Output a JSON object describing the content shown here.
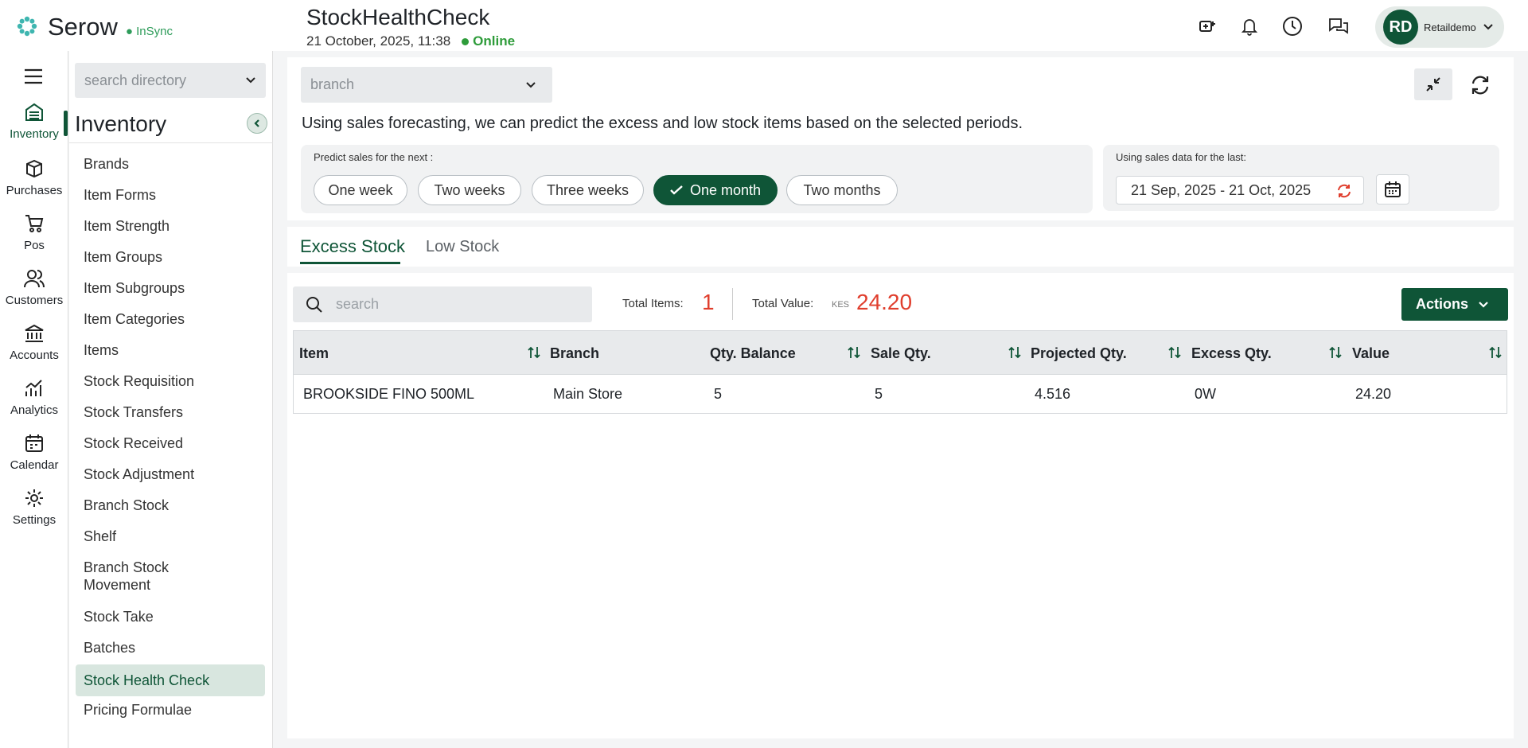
{
  "brand": {
    "name": "Serow",
    "sync_status": "InSync"
  },
  "header": {
    "title": "StockHealthCheck",
    "datetime": "21 October, 2025, 11:38",
    "connection": "Online",
    "user": {
      "initials": "RD",
      "name": "Retaildemo"
    }
  },
  "rail": {
    "items": [
      {
        "label": "Inventory",
        "icon": "inventory-icon"
      },
      {
        "label": "Purchases",
        "icon": "box-icon"
      },
      {
        "label": "Pos",
        "icon": "cart-icon"
      },
      {
        "label": "Customers",
        "icon": "users-icon"
      },
      {
        "label": "Accounts",
        "icon": "bank-icon"
      },
      {
        "label": "Analytics",
        "icon": "analytics-icon"
      },
      {
        "label": "Calendar",
        "icon": "calendar-icon"
      },
      {
        "label": "Settings",
        "icon": "gear-icon"
      }
    ]
  },
  "sidebar": {
    "search_placeholder": "search directory",
    "title": "Inventory",
    "items": [
      {
        "label": "Brands"
      },
      {
        "label": "Item Forms"
      },
      {
        "label": "Item Strength"
      },
      {
        "label": "Item Groups"
      },
      {
        "label": "Item Subgroups"
      },
      {
        "label": "Item Categories"
      },
      {
        "label": "Items"
      },
      {
        "label": "Stock Requisition"
      },
      {
        "label": "Stock Transfers"
      },
      {
        "label": "Stock Received"
      },
      {
        "label": "Stock Adjustment"
      },
      {
        "label": "Branch Stock"
      },
      {
        "label": "Shelf"
      },
      {
        "label": "Branch Stock Movement"
      },
      {
        "label": "Stock Take"
      },
      {
        "label": "Batches"
      },
      {
        "label": "Stock Health Check"
      },
      {
        "label": "Pricing Formulae"
      }
    ],
    "active": "Stock Health Check"
  },
  "main": {
    "branch_placeholder": "branch",
    "description": "Using sales forecasting, we can predict the excess and low stock items based on the selected periods.",
    "predict_label": "Predict sales for the next :",
    "periods": [
      "One week",
      "Two weeks",
      "Three weeks",
      "One month",
      "Two months"
    ],
    "selected_period": "One month",
    "sales_data_label": "Using sales data for the last:",
    "date_range": "21 Sep, 2025 - 21 Oct, 2025",
    "tabs": [
      "Excess Stock",
      "Low Stock"
    ],
    "active_tab": "Excess Stock",
    "search_placeholder": "search",
    "total_items_label": "Total Items:",
    "total_items": "1",
    "total_value_label": "Total Value:",
    "currency": "KES",
    "total_value": "24.20",
    "actions_label": "Actions",
    "table": {
      "columns": [
        "Item",
        "Branch",
        "Qty. Balance",
        "Sale Qty.",
        "Projected Qty.",
        "Excess Qty.",
        "Value"
      ],
      "rows": [
        [
          "BROOKSIDE FINO 500ML",
          "Main Store",
          "5",
          "5",
          "4.516",
          "0W",
          "24.20"
        ]
      ]
    }
  },
  "colors": {
    "primary": "#0f5537",
    "accent_red": "#e03e2d",
    "online_green": "#2e9c3a"
  }
}
